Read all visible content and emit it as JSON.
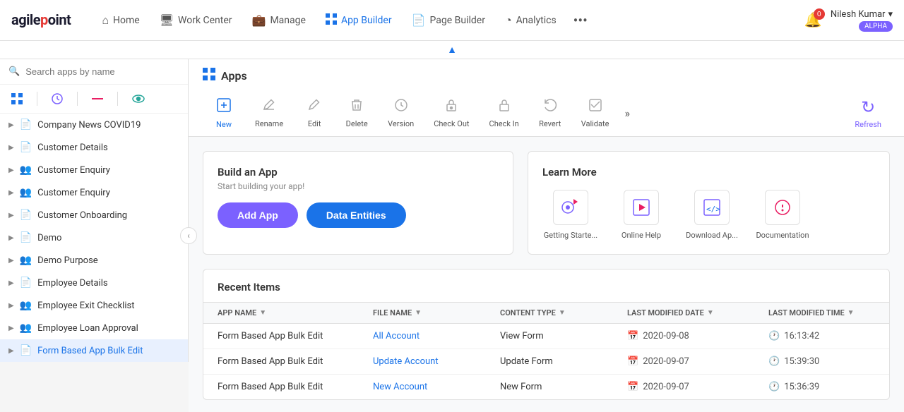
{
  "logo": {
    "text_agile": "agilepoint"
  },
  "nav": {
    "items": [
      {
        "id": "home",
        "label": "Home",
        "icon": "⌂",
        "active": false
      },
      {
        "id": "workcenter",
        "label": "Work Center",
        "icon": "🖥",
        "active": false
      },
      {
        "id": "manage",
        "label": "Manage",
        "icon": "💼",
        "active": false
      },
      {
        "id": "appbuilder",
        "label": "App Builder",
        "icon": "⊞",
        "active": true
      },
      {
        "id": "pagebuilder",
        "label": "Page Builder",
        "icon": "📄",
        "active": false
      },
      {
        "id": "analytics",
        "label": "Analytics",
        "icon": "◔",
        "active": false
      }
    ],
    "more_label": "•••",
    "notification_count": "0",
    "user_name": "Nilesh Kumar",
    "user_chevron": "▾",
    "user_badge": "ALPHA"
  },
  "collapse_chevron": "▲",
  "sidebar": {
    "search_placeholder": "Search apps by name",
    "icons": [
      {
        "id": "grid",
        "symbol": "⊞",
        "class": "active-blue"
      },
      {
        "id": "clock",
        "symbol": "⊙",
        "class": "active-purple"
      },
      {
        "id": "minus",
        "symbol": "▬",
        "class": "active-pink"
      },
      {
        "id": "eye",
        "symbol": "👁",
        "class": "active-eye"
      }
    ],
    "items": [
      {
        "label": "Company News COVID19",
        "icon": "📄",
        "has_arrow": true
      },
      {
        "label": "Customer Details",
        "icon": "📄",
        "has_arrow": true
      },
      {
        "label": "Customer Enquiry",
        "icon": "👥",
        "has_arrow": true
      },
      {
        "label": "Customer Enquiry",
        "icon": "👥",
        "has_arrow": true
      },
      {
        "label": "Customer Onboarding",
        "icon": "📄",
        "has_arrow": true
      },
      {
        "label": "Demo",
        "icon": "📄",
        "has_arrow": true
      },
      {
        "label": "Demo Purpose",
        "icon": "👥",
        "has_arrow": true
      },
      {
        "label": "Employee Details",
        "icon": "📄",
        "has_arrow": true
      },
      {
        "label": "Employee Exit Checklist",
        "icon": "👥",
        "has_arrow": true
      },
      {
        "label": "Employee Loan Approval",
        "icon": "👥",
        "has_arrow": true
      },
      {
        "label": "Form Based App Bulk Edit",
        "icon": "📄",
        "has_arrow": true,
        "selected": true
      }
    ],
    "collapse_icon": "‹"
  },
  "apps_header": {
    "title": "Apps",
    "grid_icon": "⊞"
  },
  "toolbar": {
    "items": [
      {
        "id": "new",
        "label": "New",
        "icon": "⊞+",
        "active": true
      },
      {
        "id": "rename",
        "label": "Rename",
        "icon": "✏",
        "active": false
      },
      {
        "id": "edit",
        "label": "Edit",
        "icon": "✎",
        "active": false
      },
      {
        "id": "delete",
        "label": "Delete",
        "icon": "🗑",
        "active": false
      },
      {
        "id": "version",
        "label": "Version",
        "icon": "⊙",
        "active": false
      },
      {
        "id": "checkout",
        "label": "Check Out",
        "icon": "🔓",
        "active": false
      },
      {
        "id": "checkin",
        "label": "Check In",
        "icon": "🔒",
        "active": false
      },
      {
        "id": "revert",
        "label": "Revert",
        "icon": "↩",
        "active": false
      },
      {
        "id": "validate",
        "label": "Validate",
        "icon": "✓",
        "active": false
      }
    ],
    "more_label": "»",
    "refresh_label": "Refresh",
    "refresh_icon": "↻"
  },
  "build_panel": {
    "title": "Build an App",
    "subtitle": "Start building your app!",
    "add_app_label": "Add App",
    "data_entities_label": "Data Entities"
  },
  "learn_panel": {
    "title": "Learn More",
    "items": [
      {
        "id": "getting-started",
        "icon": "🔍▶",
        "label": "Getting Starte..."
      },
      {
        "id": "online-help",
        "icon": "▶⊙",
        "label": "Online Help"
      },
      {
        "id": "download-app",
        "icon": "</> ",
        "label": "Download Ap..."
      },
      {
        "id": "documentation",
        "icon": "💡",
        "label": "Documentation"
      }
    ]
  },
  "recent": {
    "title": "Recent Items",
    "columns": [
      {
        "id": "app_name",
        "label": "APP NAME"
      },
      {
        "id": "file_name",
        "label": "FILE NAME"
      },
      {
        "id": "content_type",
        "label": "CONTENT TYPE"
      },
      {
        "id": "last_modified_date",
        "label": "LAST MODIFIED DATE"
      },
      {
        "id": "last_modified_time",
        "label": "LAST MODIFIED TIME"
      }
    ],
    "rows": [
      {
        "app_name": "Form Based App Bulk Edit",
        "file_name": "All Account",
        "content_type": "View Form",
        "last_modified_date": "2020-09-08",
        "last_modified_time": "16:13:42"
      },
      {
        "app_name": "Form Based App Bulk Edit",
        "file_name": "Update Account",
        "content_type": "Update Form",
        "last_modified_date": "2020-09-07",
        "last_modified_time": "15:39:30"
      },
      {
        "app_name": "Form Based App Bulk Edit",
        "file_name": "New Account",
        "content_type": "New Form",
        "last_modified_date": "2020-09-07",
        "last_modified_time": "15:36:39"
      }
    ]
  }
}
